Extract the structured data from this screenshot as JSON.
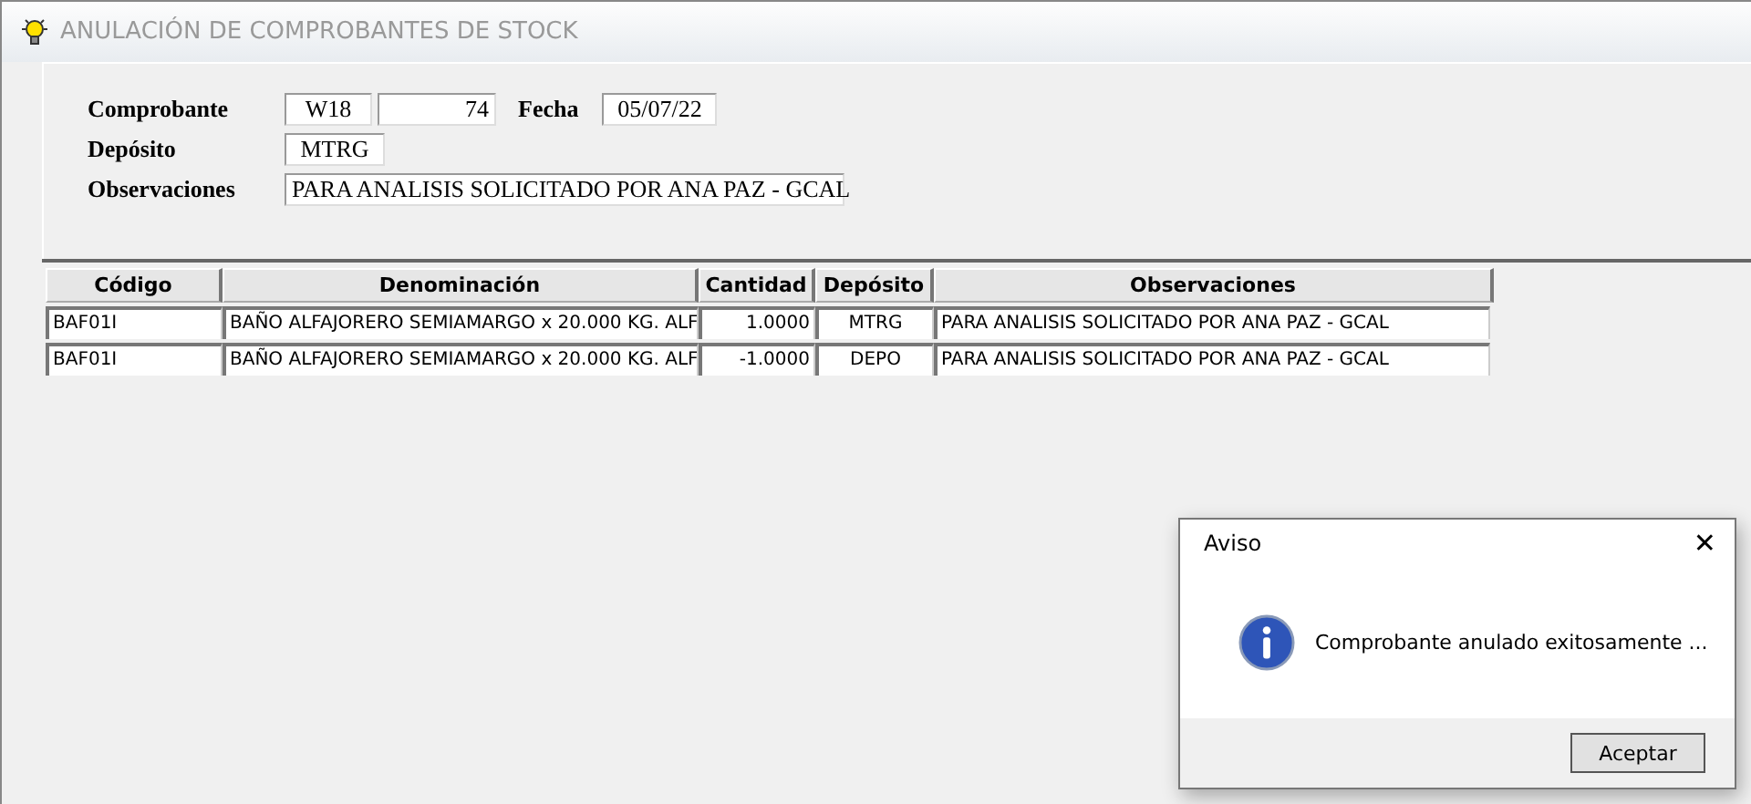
{
  "window": {
    "title": "ANULACIÓN DE COMPROBANTES DE STOCK"
  },
  "form": {
    "comprobante_label": "Comprobante",
    "comprobante_series": "W18",
    "comprobante_number": "74",
    "fecha_label": "Fecha",
    "fecha": "05/07/22",
    "deposito_label": "Depósito",
    "deposito": "MTRG",
    "observaciones_label": "Observaciones",
    "observaciones": "PARA ANALISIS SOLICITADO POR ANA PAZ - GCAL"
  },
  "table": {
    "columns": [
      "Código",
      "Denominación",
      "Cantidad",
      "Depósito",
      "Observaciones"
    ],
    "rows": [
      [
        "BAF01I",
        "BAÑO ALFAJORERO SEMIAMARGO   x 20.000 KG. ALF",
        "1.0000",
        "MTRG",
        "PARA ANALISIS SOLICITADO POR ANA PAZ - GCAL"
      ],
      [
        "BAF01I",
        "BAÑO ALFAJORERO SEMIAMARGO   x 20.000 KG. ALF",
        "-1.0000",
        "DEPO",
        "PARA ANALISIS SOLICITADO POR ANA PAZ - GCAL"
      ]
    ]
  },
  "dialog": {
    "title": "Aviso",
    "close": "✕",
    "message": "Comprobante anulado exitosamente ...",
    "buttons": [
      "Aceptar"
    ]
  }
}
